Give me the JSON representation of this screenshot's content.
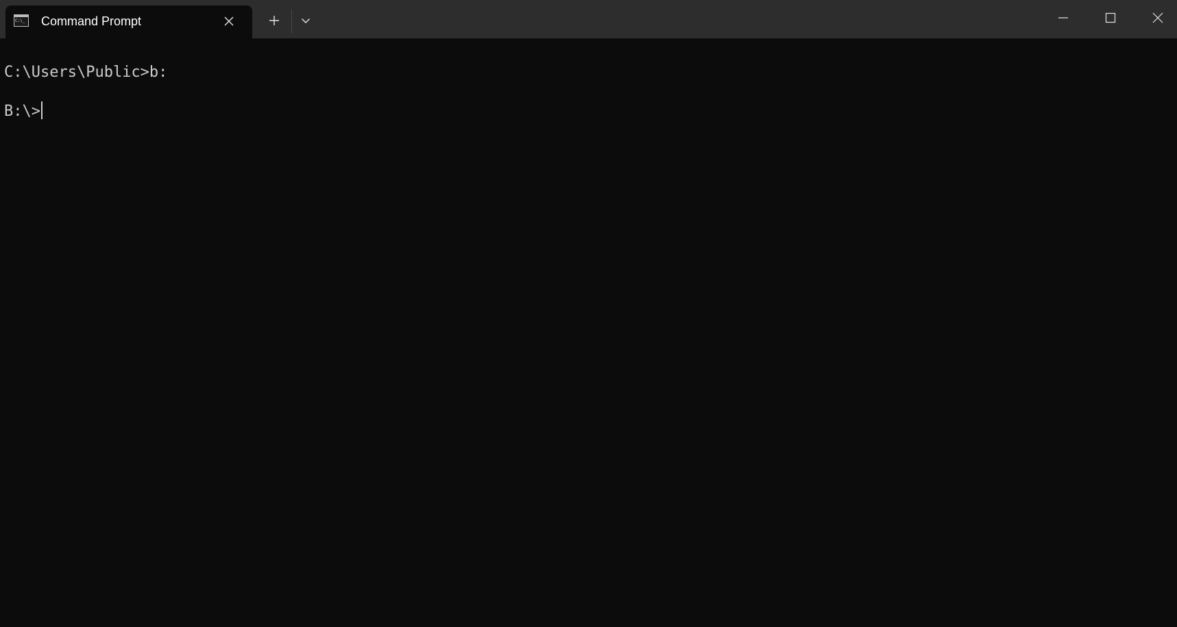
{
  "window": {
    "tab_title": "Command Prompt",
    "tab_icon": "cmd-icon",
    "buttons": {
      "new_tab_icon": "plus-icon",
      "dropdown_icon": "chevron-down-icon",
      "tab_close_icon": "close-icon",
      "minimize_icon": "minimize-icon",
      "maximize_icon": "maximize-icon",
      "close_icon": "close-icon"
    }
  },
  "terminal": {
    "lines": [
      "C:\\Users\\Public>b:",
      "",
      "B:\\>"
    ],
    "text_color": "#cccccc",
    "background": "#0c0c0c"
  },
  "colors": {
    "titlebar": "#2d2d2d",
    "active_tab": "#0c0c0c",
    "text": "#ffffff"
  }
}
